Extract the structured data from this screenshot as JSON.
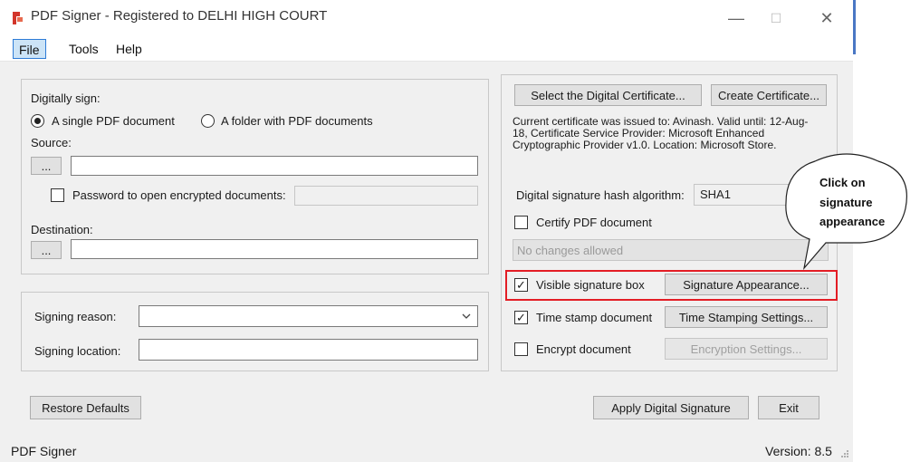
{
  "window": {
    "title": "PDF Signer - Registered to DELHI HIGH COURT",
    "controls": {
      "minimize": "—",
      "maximize": "☐",
      "close": "✕"
    }
  },
  "menu": [
    "File",
    "Tools",
    "Help"
  ],
  "sign_group": {
    "heading": "Digitally sign:",
    "option_single": "A single PDF document",
    "option_folder": "A folder with PDF documents",
    "selected_option": "single",
    "source_label": "Source:",
    "source_value": "",
    "browse_label": "...",
    "password_label": "Password to open encrypted documents:",
    "password_checked": false,
    "password_value": "",
    "destination_label": "Destination:",
    "destination_value": ""
  },
  "reason_group": {
    "signing_reason_label": "Signing reason:",
    "signing_reason_value": "",
    "signing_location_label": "Signing location:",
    "signing_location_value": ""
  },
  "cert_group": {
    "select_button": "Select the Digital Certificate...",
    "create_button": "Create Certificate...",
    "cert_info": "Current certificate was issued to: Avinash. Valid until: 12-Aug-18, Certificate Service Provider: Microsoft Enhanced Cryptographic Provider v1.0. Location: Microsoft Store.",
    "hash_label": "Digital signature hash algorithm:",
    "hash_value": "SHA1",
    "certify_label": "Certify PDF document",
    "certify_checked": false,
    "certify_option": "No changes allowed",
    "visible_box_label": "Visible signature box",
    "visible_box_checked": true,
    "appearance_button": "Signature Appearance...",
    "timestamp_label": "Time stamp document",
    "timestamp_checked": true,
    "timestamp_button": "Time Stamping Settings...",
    "encrypt_label": "Encrypt document",
    "encrypt_checked": false,
    "encrypt_button": "Encryption Settings..."
  },
  "footer": {
    "restore_button": "Restore Defaults",
    "apply_button": "Apply Digital Signature",
    "exit_button": "Exit"
  },
  "status": {
    "left": "PDF Signer",
    "right": "Version: 8.5"
  },
  "callout": {
    "line1": "Click on",
    "line2": "signature",
    "line3": "appearance"
  },
  "colors": {
    "highlight": "#e31d25",
    "menu_selected": "#cce4f7",
    "app_icon": "#d2352b"
  }
}
